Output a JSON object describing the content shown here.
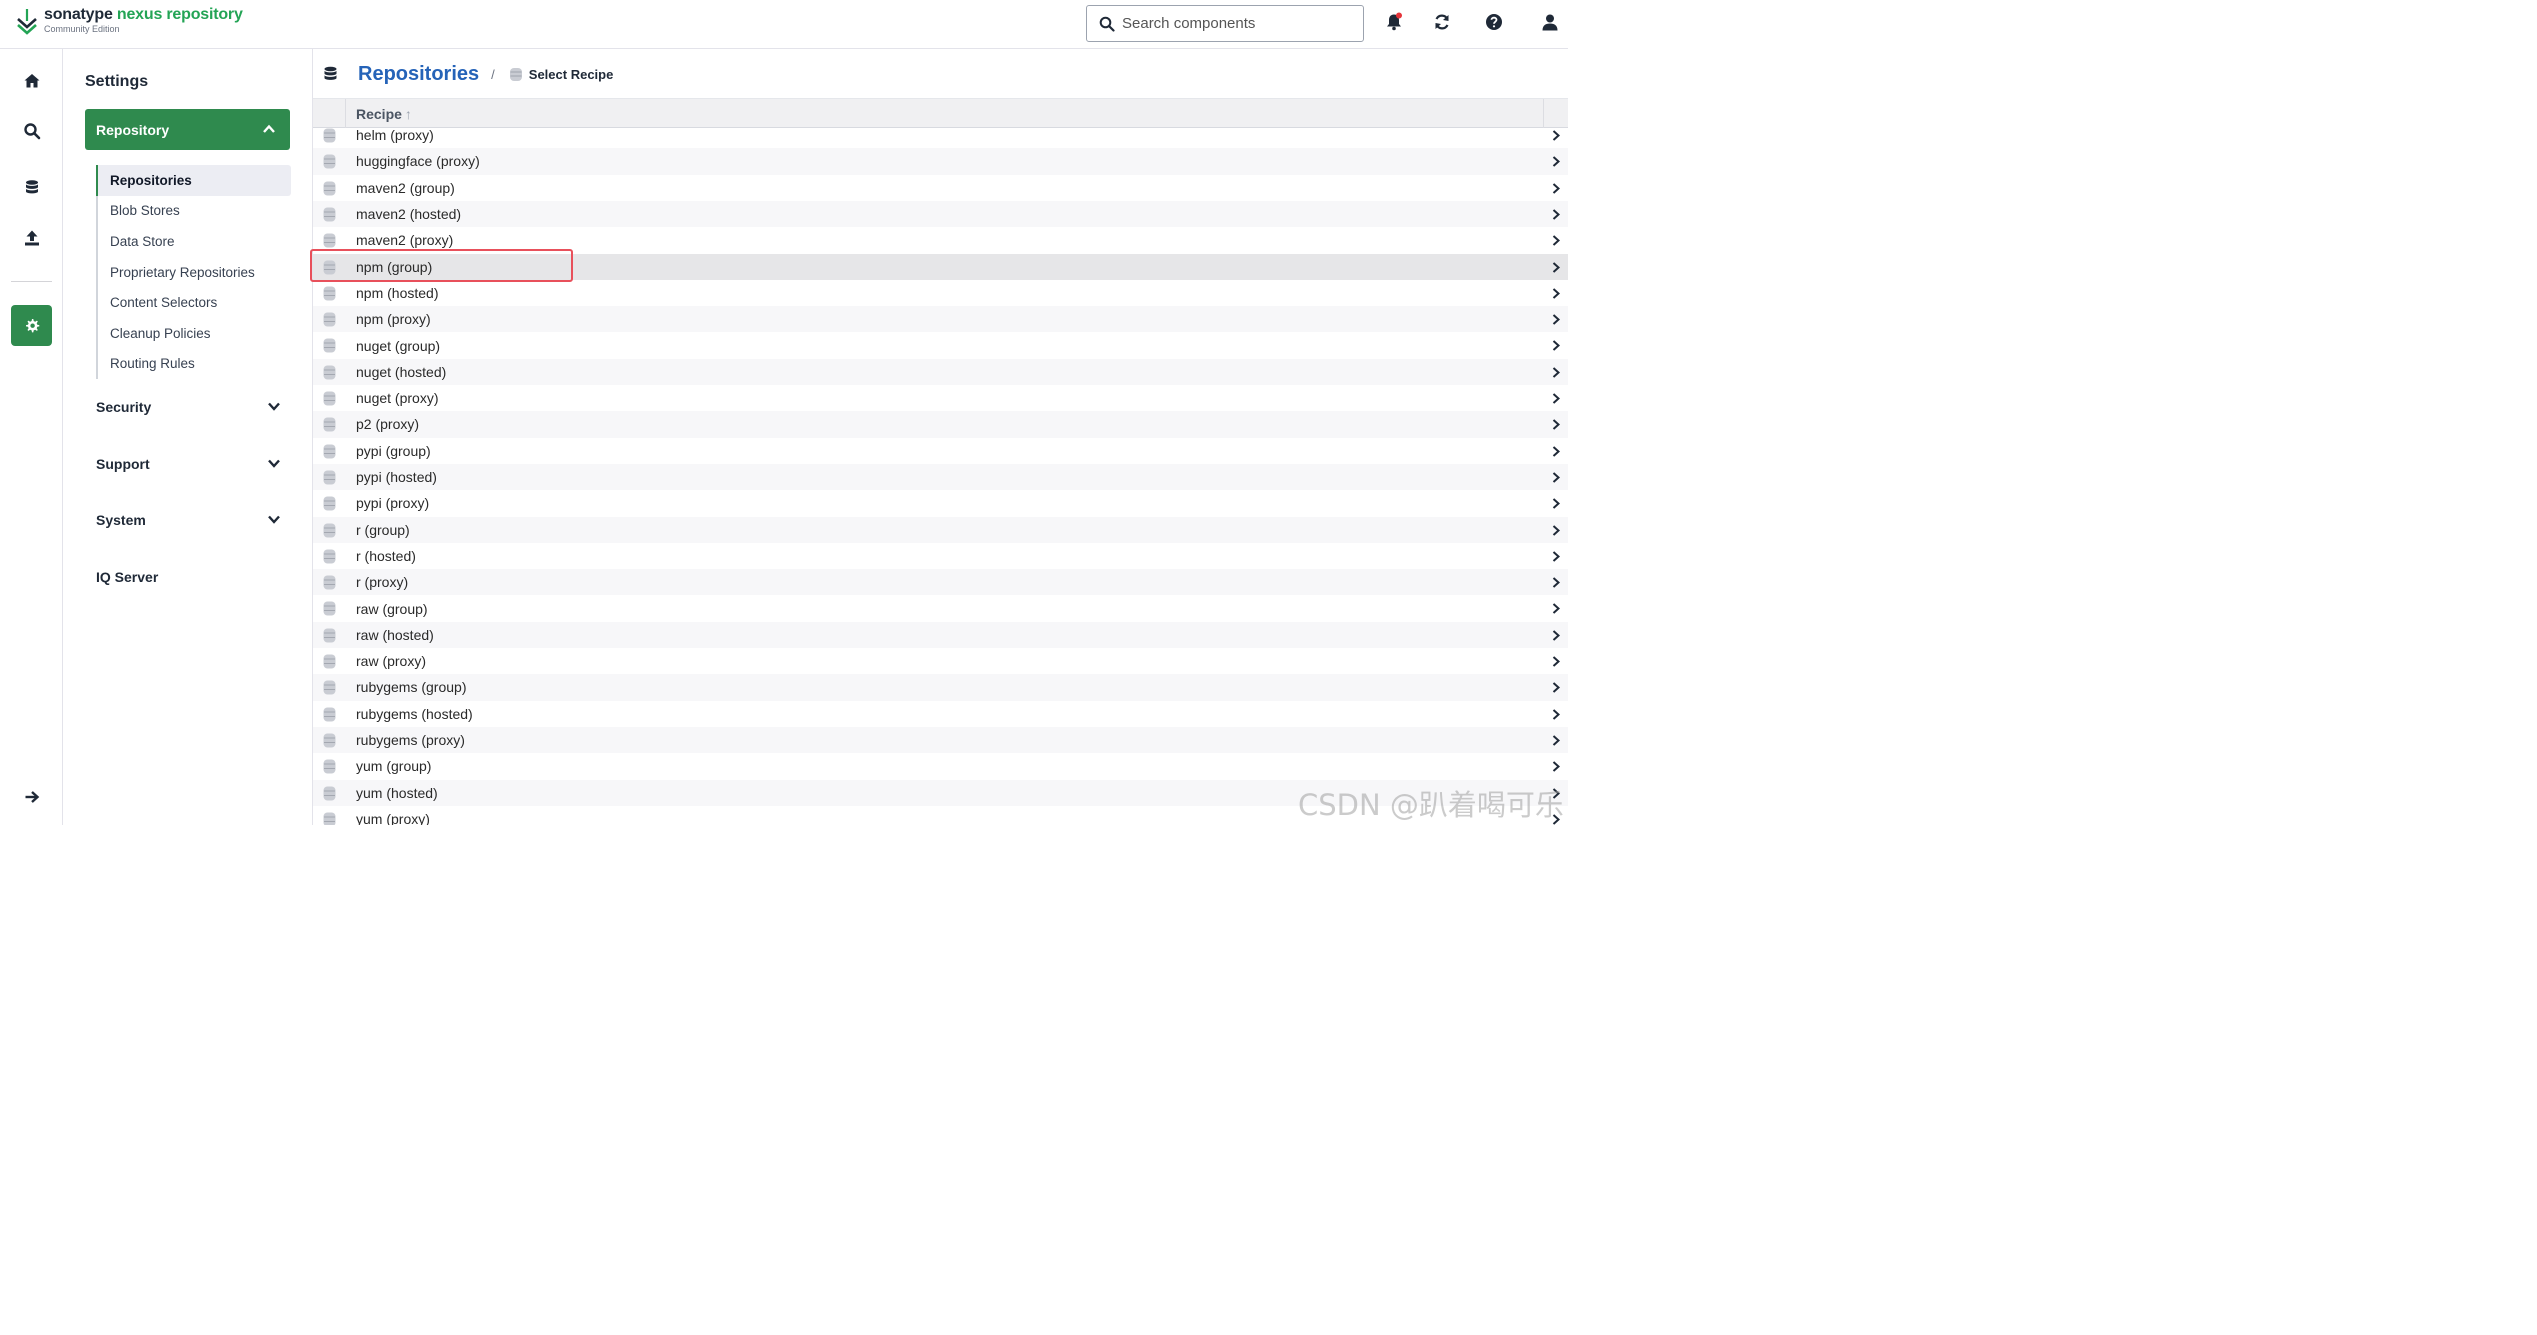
{
  "header": {
    "brand_primary": "sonatype",
    "brand_accent": "nexus repository",
    "edition": "Community Edition",
    "search_placeholder": "Search components",
    "icons": [
      "bell-icon",
      "refresh-icon",
      "help-icon",
      "user-icon"
    ],
    "accent_color": "#23a455"
  },
  "rail": {
    "items": [
      "home-icon",
      "search-icon",
      "database-icon",
      "upload-icon",
      "settings-icon"
    ],
    "collapse_icon": "arrow-right-icon",
    "active_color": "#2f8a4e"
  },
  "sidebar": {
    "title": "Settings",
    "repository_group": {
      "label": "Repository",
      "items": [
        {
          "label": "Repositories",
          "active": true
        },
        {
          "label": "Blob Stores"
        },
        {
          "label": "Data Store"
        },
        {
          "label": "Proprietary Repositories"
        },
        {
          "label": "Content Selectors"
        },
        {
          "label": "Cleanup Policies"
        },
        {
          "label": "Routing Rules"
        }
      ]
    },
    "groups": [
      {
        "label": "Security"
      },
      {
        "label": "Support"
      },
      {
        "label": "System"
      }
    ],
    "iq_server": "IQ Server"
  },
  "main": {
    "breadcrumb_title": "Repositories",
    "breadcrumb_separator": "/",
    "breadcrumb_current": "Select Recipe",
    "column_header": "Recipe",
    "sort_indicator": "↑",
    "rows": [
      "helm (proxy)",
      "huggingface (proxy)",
      "maven2 (group)",
      "maven2 (hosted)",
      "maven2 (proxy)",
      "npm (group)",
      "npm (hosted)",
      "npm (proxy)",
      "nuget (group)",
      "nuget (hosted)",
      "nuget (proxy)",
      "p2 (proxy)",
      "pypi (group)",
      "pypi (hosted)",
      "pypi (proxy)",
      "r (group)",
      "r (hosted)",
      "r (proxy)",
      "raw (group)",
      "raw (hosted)",
      "raw (proxy)",
      "rubygems (group)",
      "rubygems (hosted)",
      "rubygems (proxy)",
      "yum (group)",
      "yum (hosted)",
      "yum (proxy)"
    ],
    "selected_row": "npm (group)",
    "highlight_color": "#e8505b"
  },
  "watermark": "CSDN @趴着喝可乐"
}
